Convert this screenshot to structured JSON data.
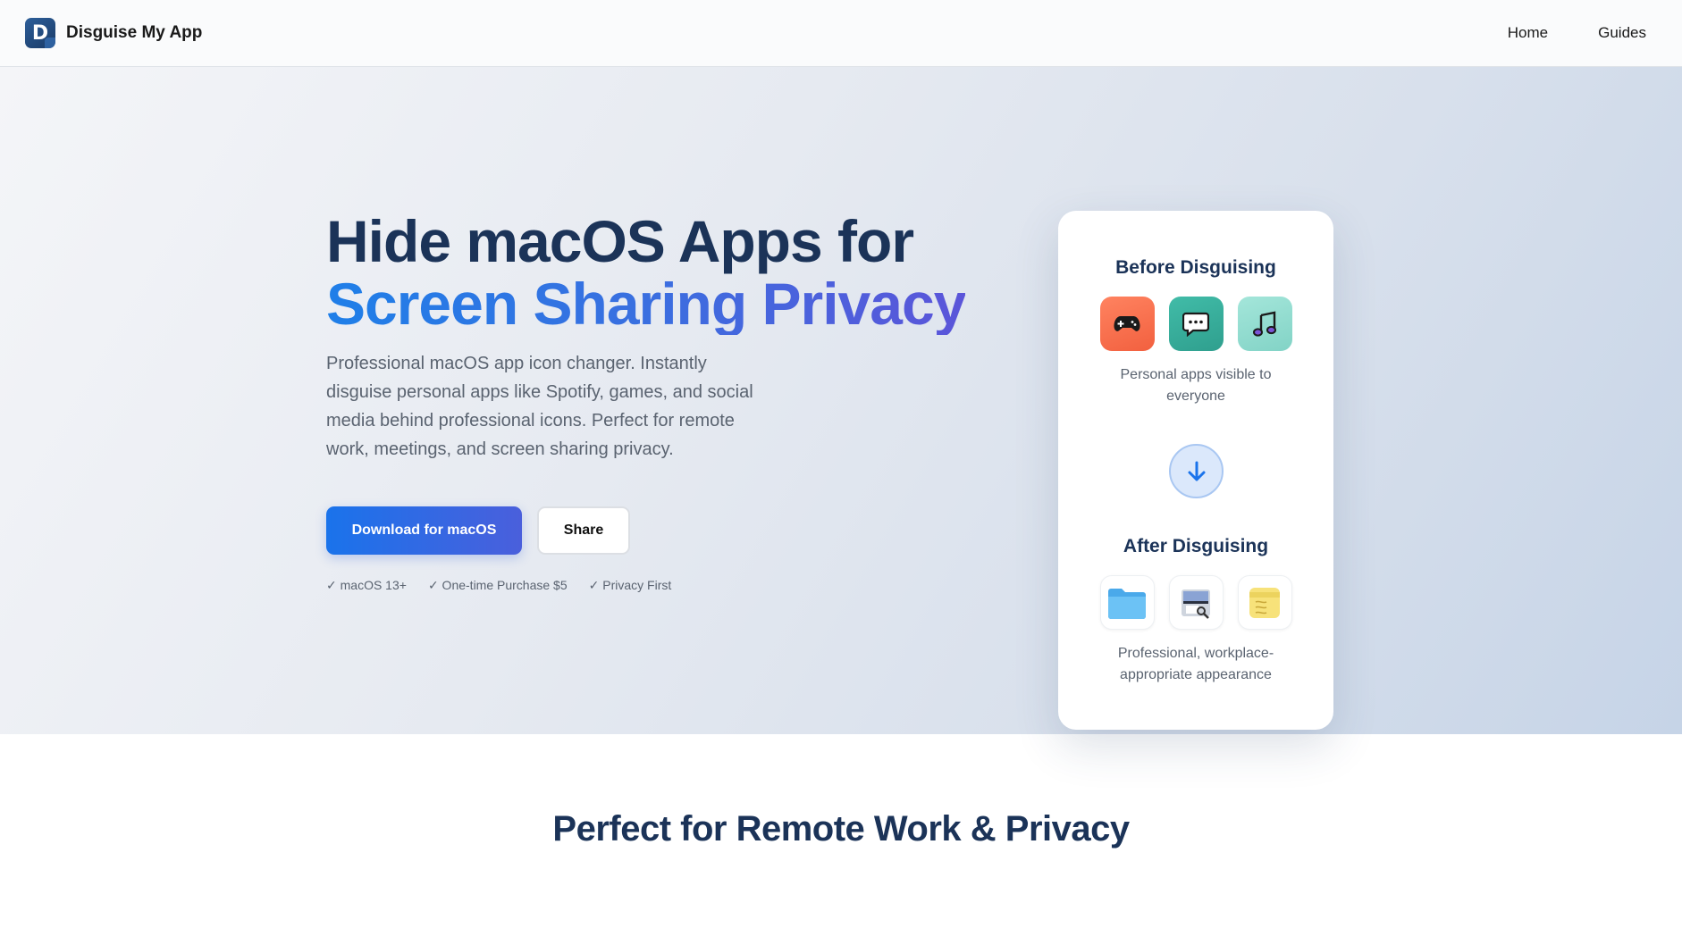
{
  "header": {
    "logo_letter": "D",
    "brand": "Disguise My App",
    "nav": [
      "Home",
      "Guides"
    ]
  },
  "hero": {
    "title_line1": "Hide macOS Apps for",
    "title_line2": "Screen Sharing Privacy",
    "subtitle": "Professional macOS app icon changer. Instantly disguise personal apps like Spotify, games, and social media behind professional icons. Perfect for remote work, meetings, and screen sharing privacy.",
    "primary_button": "Download for macOS",
    "secondary_button": "Share",
    "badges": [
      "✓ macOS 13+",
      "✓ One-time Purchase $5",
      "✓ Privacy First"
    ]
  },
  "card": {
    "before_title": "Before Disguising",
    "before_icons": [
      "gamepad-icon",
      "chat-bubble-icon",
      "music-note-icon"
    ],
    "before_caption": "Personal apps visible to everyone",
    "arrow": "arrow-down-icon",
    "after_title": "After Disguising",
    "after_icons": [
      "folder-icon",
      "preview-icon",
      "stickies-icon"
    ],
    "after_caption": "Professional, workplace-appropriate appearance"
  },
  "section": {
    "title": "Perfect for Remote Work & Privacy"
  },
  "colors": {
    "accent_blue": "#1a73eb",
    "accent_purple": "#5b55d9",
    "heading_navy": "#1b3358"
  }
}
